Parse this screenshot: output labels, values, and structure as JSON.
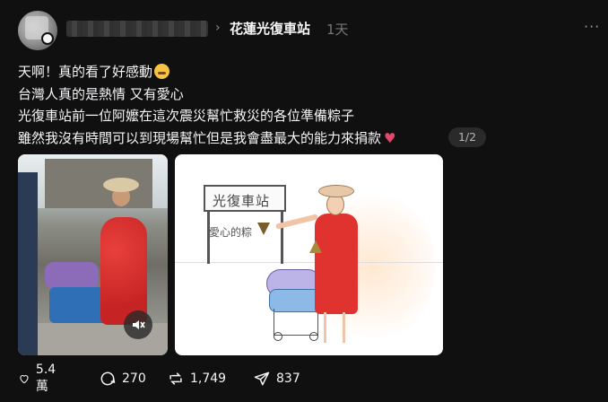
{
  "header": {
    "page_name": "花蓮光復車站",
    "time_ago": "1天",
    "separator_icon": "chevron-right-icon",
    "more_icon": "more-icon"
  },
  "post": {
    "lines": [
      "天啊！真的看了好感動",
      "台灣人真的是熱情 又有愛心",
      "光復車站前一位阿嬤在這次震災幫忙救災的各位準備粽子",
      "雖然我沒有時間可以到現場幫忙但是我會盡最大的能力來捐款"
    ],
    "emoji_icon": "crying-face-icon",
    "heart": "♥",
    "page_count": "1/2"
  },
  "media": {
    "photo_icon": "mute-icon",
    "drawing_sign": "光復車站",
    "drawing_scribble": "愛心的粽"
  },
  "actions": {
    "likes": "5.4 萬",
    "comments": "270",
    "reposts": "1,749",
    "shares": "837"
  },
  "colors": {
    "background": "#101010",
    "text": "#f3f5f7",
    "muted": "#777777",
    "heart": "#e2476e"
  }
}
